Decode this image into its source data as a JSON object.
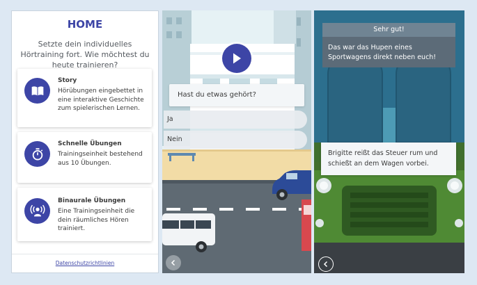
{
  "home": {
    "title": "HOME",
    "subtitle": "Setzte dein individuelles Hörtraining fort. Wie möchtest du heute trainieren?",
    "cards": [
      {
        "title": "Story",
        "text": "Hörübungen eingebettet in eine interaktive Geschichte zum spielerischen Lernen.",
        "icon": "book-icon"
      },
      {
        "title": "Schnelle Übungen",
        "text": "Trainingseinheit bestehend aus 10 Übungen.",
        "icon": "stopwatch-icon"
      },
      {
        "title": "Binaurale Übungen",
        "text": "Eine Trainingseinheit die dein räumliches Hören trainiert.",
        "icon": "spatial-audio-icon"
      }
    ],
    "privacy_link": "Datenschutzrichtlinien"
  },
  "quiz": {
    "question": "Hast du etwas gehört?",
    "options": [
      "Ja",
      "Nein"
    ]
  },
  "feedback": {
    "header": "Sehr gut!",
    "message": "Das war das Hupen eines Sportwagens direkt neben euch!",
    "narration": "Brigitte reißt das Steuer rum und schießt an dem Wagen vorbei."
  },
  "colors": {
    "accent": "#3d45a6",
    "background": "#dde8f3",
    "truck_green": "#4f8a34",
    "feedback_header": "#708493",
    "feedback_body": "#5c6b78"
  }
}
